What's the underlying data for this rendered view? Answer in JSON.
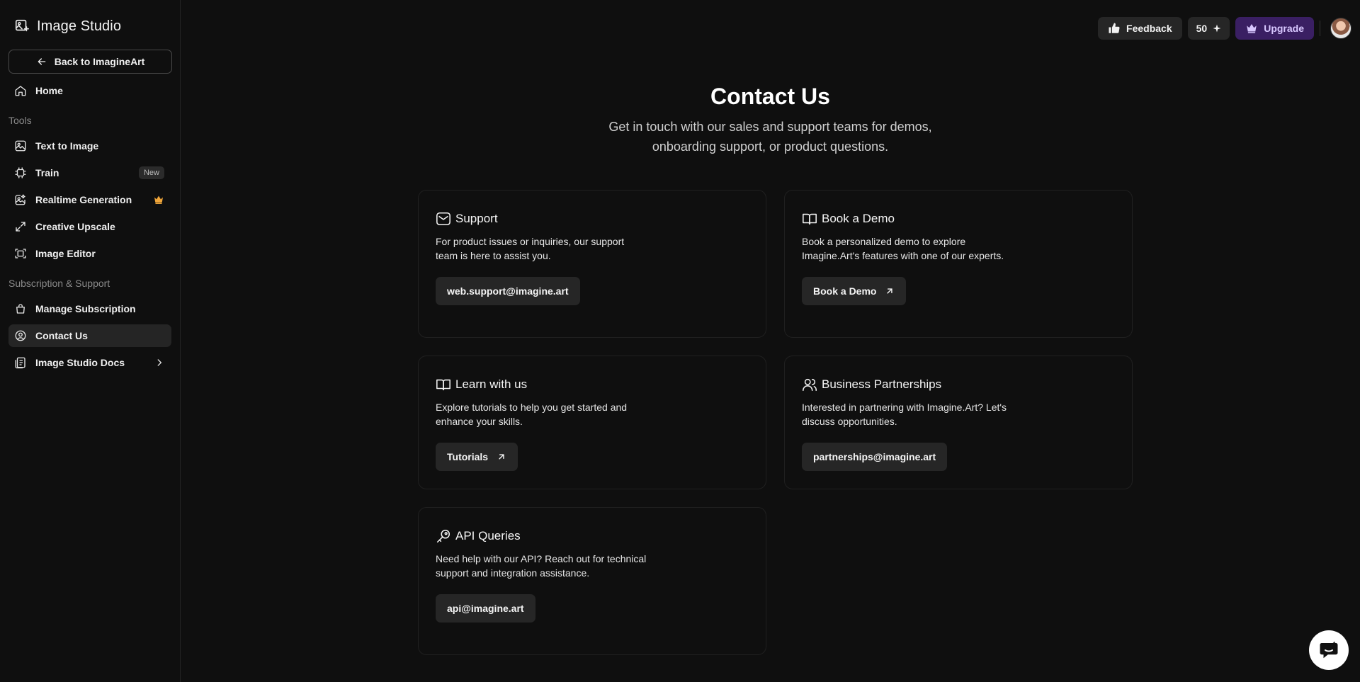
{
  "app": {
    "title": "Image Studio"
  },
  "sidebar": {
    "back_label": "Back to ImagineArt",
    "home_label": "Home",
    "tools_label": "Tools",
    "tools": [
      {
        "label": "Text to Image",
        "icon": "image-icon"
      },
      {
        "label": "Train",
        "icon": "chip-icon",
        "badge": "New"
      },
      {
        "label": "Realtime Generation",
        "icon": "realtime-icon",
        "badge_icon": "crown-icon"
      },
      {
        "label": "Creative Upscale",
        "icon": "expand-icon"
      },
      {
        "label": "Image Editor",
        "icon": "editor-icon"
      }
    ],
    "support_label": "Subscription & Support",
    "support_items": [
      {
        "label": "Manage Subscription",
        "icon": "bag-icon"
      },
      {
        "label": "Contact Us",
        "icon": "contact-icon",
        "active": true
      },
      {
        "label": "Image Studio Docs",
        "icon": "docs-icon"
      }
    ]
  },
  "header": {
    "feedback_label": "Feedback",
    "credits": "50",
    "upgrade_label": "Upgrade"
  },
  "main": {
    "title": "Contact Us",
    "subtitle": "Get in touch with our sales and support teams for demos, onboarding support, or product questions.",
    "cards": [
      {
        "title": "Support",
        "icon": "mail-icon",
        "description": "For product issues or inquiries, our support team is here to assist you.",
        "button": "web.support@imagine.art"
      },
      {
        "title": "Book a Demo",
        "icon": "book-icon",
        "description": "Book a personalized demo to explore Imagine.Art's features with one of our experts.",
        "button": "Book a Demo"
      },
      {
        "title": "Learn with us",
        "icon": "book-icon",
        "description": "Explore tutorials to help you get started and enhance your skills.",
        "button": "Tutorials"
      },
      {
        "title": "Business Partnerships",
        "icon": "users-icon",
        "description": "Interested in partnering with Imagine.Art? Let's discuss opportunities.",
        "button": "partnerships@imagine.art"
      },
      {
        "title": "API Queries",
        "icon": "key-icon",
        "description": "Need help with our API? Reach out for technical support and integration assistance.",
        "button": "api@imagine.art"
      }
    ]
  },
  "colors": {
    "background": "#0f0f0f",
    "card_button": "#262626",
    "upgrade_bg": "#3a1f63",
    "upgrade_text": "#d8c7ff",
    "crown": "#f0a63a"
  }
}
